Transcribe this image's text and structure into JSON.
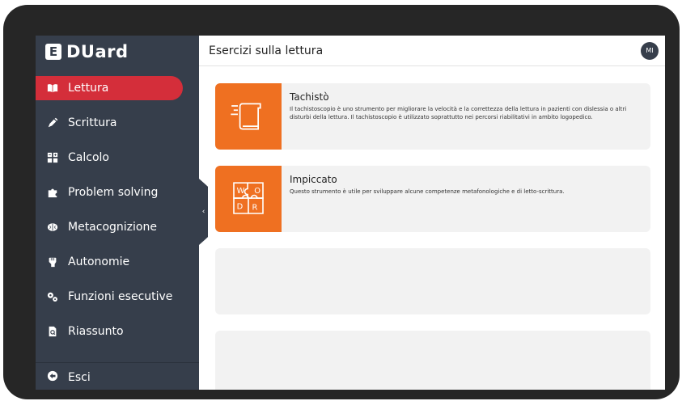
{
  "app": {
    "logo_letter": "E",
    "logo_text": "DUard"
  },
  "sidebar": {
    "items": [
      {
        "label": "Lettura",
        "icon": "book-icon",
        "active": true
      },
      {
        "label": "Scrittura",
        "icon": "pen-icon",
        "active": false
      },
      {
        "label": "Calcolo",
        "icon": "calculator-icon",
        "active": false
      },
      {
        "label": "Problem solving",
        "icon": "puzzle-icon",
        "active": false
      },
      {
        "label": "Metacognizione",
        "icon": "brain-icon",
        "active": false
      },
      {
        "label": "Autonomie",
        "icon": "fist-icon",
        "active": false
      },
      {
        "label": "Funzioni esecutive",
        "icon": "gears-icon",
        "active": false
      },
      {
        "label": "Riassunto",
        "icon": "document-search-icon",
        "active": false
      }
    ],
    "exit_label": "Esci",
    "collapse_glyph": "‹"
  },
  "header": {
    "title": "Esercizi sulla lettura",
    "avatar_initials": "MI"
  },
  "cards": [
    {
      "title": "Tachistò",
      "description": "Il tachistoscopio è uno strumento per migliorare la velocità e la correttezza della lettura in pazienti con dislessia o altri disturbi della lettura. Il tachistoscopio è utilizzato soprattutto nei percorsi riabilitativi in ambito logopedico.",
      "icon": "fast-book-icon"
    },
    {
      "title": "Impiccato",
      "description": "Questo strumento è utile per sviluppare alcune competenze metafonologiche e di letto-scrittura.",
      "icon": "word-puzzle-icon"
    }
  ],
  "colors": {
    "sidebar_bg": "#363e4b",
    "active_item": "#d42e3a",
    "card_thumb": "#ef7021",
    "card_bg": "#f2f2f2"
  }
}
